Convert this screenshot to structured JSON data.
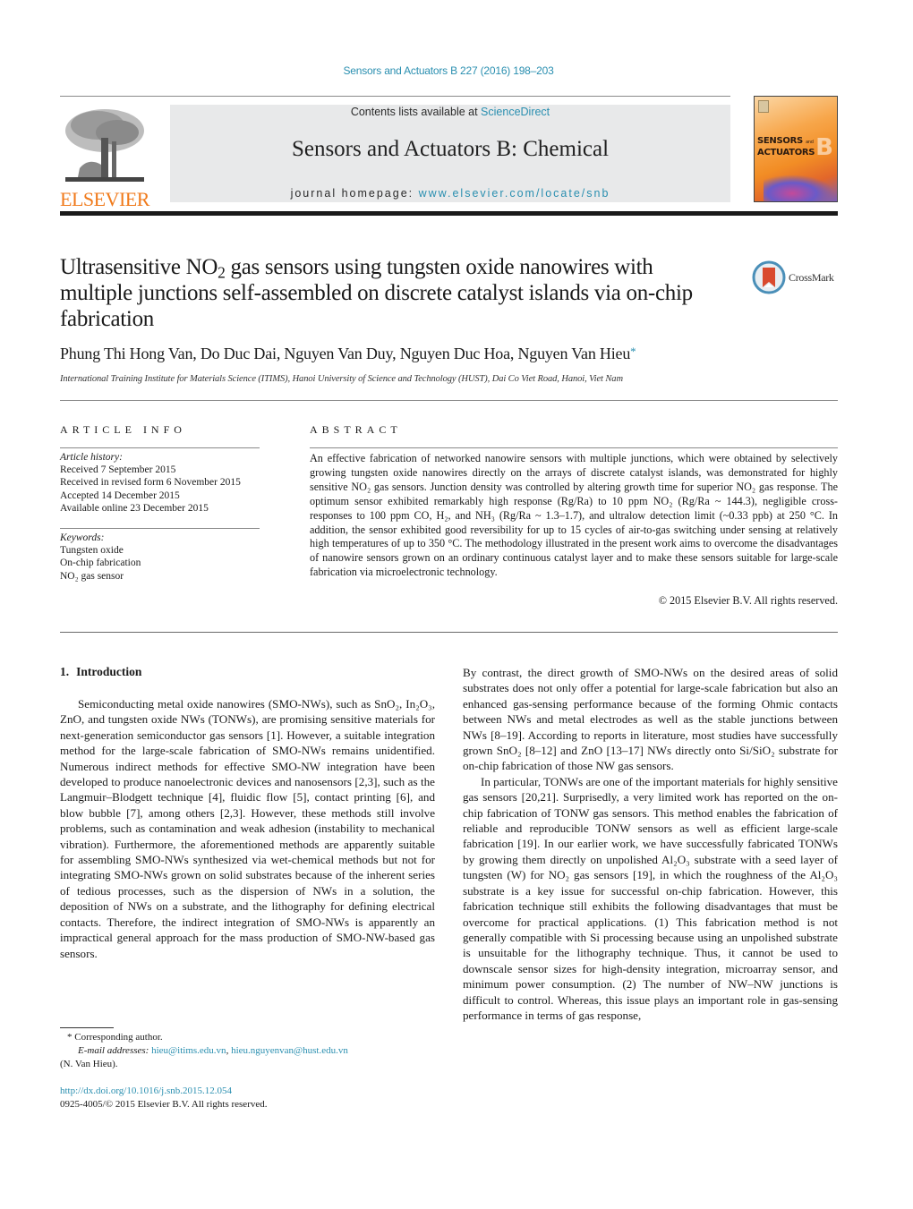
{
  "header": {
    "citation": "Sensors and Actuators B 227 (2016) 198–203",
    "contents_prefix": "Contents lists available at ",
    "contents_link": "ScienceDirect",
    "journal_name": "Sensors and Actuators B: Chemical",
    "homepage_prefix": "journal homepage: ",
    "homepage_link": "www.elsevier.com/locate/snb",
    "publisher_logo_text": "ELSEVIER",
    "cover": {
      "title_line1": "SENSORS",
      "title_and": "and",
      "title_line2": "ACTUATORS",
      "letter": "B"
    },
    "colors": {
      "link": "#2a8fb0",
      "elsevier_orange": "#f07a1b",
      "banner_bg": "#e8e9ea"
    }
  },
  "article": {
    "title_part1": "Ultrasensitive NO",
    "title_sub": "2",
    "title_part2": " gas sensors using tungsten oxide nanowires with multiple junctions self-assembled on discrete catalyst islands via on-chip fabrication",
    "crossmark_label": "CrossMark",
    "authors": "Phung Thi Hong Van, Do Duc Dai, Nguyen Van Duy, Nguyen Duc Hoa, Nguyen Van Hieu",
    "corresponding_mark": "*",
    "affiliation": "International Training Institute for Materials Science (ITIMS), Hanoi University of Science and Technology (HUST), Dai Co Viet Road, Hanoi, Viet Nam"
  },
  "article_info": {
    "heading": "ARTICLE INFO",
    "history_label": "Article history:",
    "history": [
      "Received 7 September 2015",
      "Received in revised form 6 November 2015",
      "Accepted 14 December 2015",
      "Available online 23 December 2015"
    ],
    "keywords_label": "Keywords:",
    "keywords": [
      "Tungsten oxide",
      "On-chip fabrication",
      "NO₂ gas sensor"
    ]
  },
  "abstract": {
    "heading": "ABSTRACT",
    "text": "An effective fabrication of networked nanowire sensors with multiple junctions, which were obtained by selectively growing tungsten oxide nanowires directly on the arrays of discrete catalyst islands, was demonstrated for highly sensitive NO₂ gas sensors. Junction density was controlled by altering growth time for superior NO₂ gas response. The optimum sensor exhibited remarkably high response (Rg/Ra) to 10 ppm NO₂ (Rg/Ra ~ 144.3), negligible cross-responses to 100 ppm CO, H₂, and NH₃ (Rg/Ra ~ 1.3–1.7), and ultralow detection limit (~0.33 ppb) at 250 °C. In addition, the sensor exhibited good reversibility for up to 15 cycles of air-to-gas switching under sensing at relatively high temperatures of up to 350 °C. The methodology illustrated in the present work aims to overcome the disadvantages of nanowire sensors grown on an ordinary continuous catalyst layer and to make these sensors suitable for large-scale fabrication via microelectronic technology.",
    "copyright": "© 2015 Elsevier B.V. All rights reserved."
  },
  "intro": {
    "number": "1.",
    "title": "Introduction",
    "left_paragraph": "Semiconducting metal oxide nanowires (SMO-NWs), such as SnO₂, In₂O₃, ZnO, and tungsten oxide NWs (TONWs), are promising sensitive materials for next-generation semiconductor gas sensors [1]. However, a suitable integration method for the large-scale fabrication of SMO-NWs remains unidentified. Numerous indirect methods for effective SMO-NW integration have been developed to produce nanoelectronic devices and nanosensors [2,3], such as the Langmuir–Blodgett technique [4], fluidic flow [5], contact printing [6], and blow bubble [7], among others [2,3]. However, these methods still involve problems, such as contamination and weak adhesion (instability to mechanical vibration). Furthermore, the aforementioned methods are apparently suitable for assembling SMO-NWs synthesized via wet-chemical methods but not for integrating SMO-NWs grown on solid substrates because of the inherent series of tedious processes, such as the dispersion of NWs in a solution, the deposition of NWs on a substrate, and the lithography for defining electrical contacts. Therefore, the indirect integration of SMO-NWs is apparently an impractical general approach for the mass production of SMO-NW-based gas sensors.",
    "right_paragraph_1": "By contrast, the direct growth of SMO-NWs on the desired areas of solid substrates does not only offer a potential for large-scale fabrication but also an enhanced gas-sensing performance because of the forming Ohmic contacts between NWs and metal electrodes as well as the stable junctions between NWs [8–19]. According to reports in literature, most studies have successfully grown SnO₂ [8–12] and ZnO [13–17] NWs directly onto Si/SiO₂ substrate for on-chip fabrication of those NW gas sensors.",
    "right_paragraph_2": "In particular, TONWs are one of the important materials for highly sensitive gas sensors [20,21]. Surprisedly, a very limited work has reported on the on-chip fabrication of TONW gas sensors. This method enables the fabrication of reliable and reproducible TONW sensors as well as efficient large-scale fabrication [19]. In our earlier work, we have successfully fabricated TONWs by growing them directly on unpolished Al₂O₃ substrate with a seed layer of tungsten (W) for NO₂ gas sensors [19], in which the roughness of the Al₂O₃ substrate is a key issue for successful on-chip fabrication. However, this fabrication technique still exhibits the following disadvantages that must be overcome for practical applications. (1) This fabrication method is not generally compatible with Si processing because using an unpolished substrate is unsuitable for the lithography technique. Thus, it cannot be used to downscale sensor sizes for high-density integration, microarray sensor, and minimum power consumption. (2) The number of NW–NW junctions is difficult to control. Whereas, this issue plays an important role in gas-sensing performance in terms of gas response,"
  },
  "footnotes": {
    "corresponding": "* Corresponding author.",
    "email_label": "E-mail addresses: ",
    "email_1": "hieu@itims.edu.vn",
    "email_sep": ", ",
    "email_2": "hieu.nguyenvan@hust.edu.vn",
    "email_owner": "(N. Van Hieu).",
    "doi": "http://dx.doi.org/10.1016/j.snb.2015.12.054",
    "issn_copyright": "0925-4005/© 2015 Elsevier B.V. All rights reserved."
  }
}
